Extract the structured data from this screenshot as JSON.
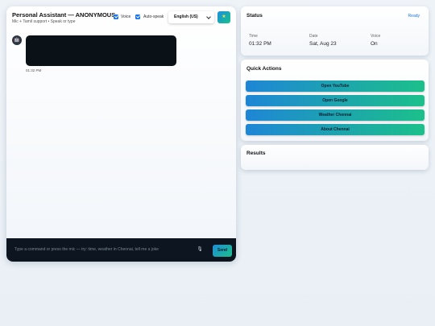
{
  "chat": {
    "title": "Personal Assistant — ANONYMOUS",
    "subtitle": "Mic + Tamil support • Speak or type",
    "voice_label": "Voice",
    "autospeak_label": "Auto-speak",
    "language": "English (US)",
    "avatar_glyph": "🤖",
    "star_glyph": "★",
    "messages": [
      {
        "sender": "assistant",
        "time": "01:32 PM",
        "content_hidden": true
      }
    ],
    "input_placeholder": "Type a command or press the mic — try: time, weather in Chennai, tell me a joke",
    "mic_glyph": "🎙",
    "send_label": "Send"
  },
  "status": {
    "title": "Status",
    "state": "Ready",
    "fields": [
      {
        "label": "Time",
        "value": "01:32 PM"
      },
      {
        "label": "Date",
        "value": "Sat, Aug 23"
      },
      {
        "label": "Voice",
        "value": "On"
      }
    ]
  },
  "quick_actions": {
    "title": "Quick Actions",
    "buttons": [
      {
        "label": "Open YouTube"
      },
      {
        "label": "Open Google"
      },
      {
        "label": "Weather Chennai"
      },
      {
        "label": "About Chennai"
      }
    ]
  },
  "results": {
    "title": "Results"
  },
  "colors": {
    "accent": "#1a73e8",
    "gradient_start": "#1e86d6",
    "gradient_end": "#1cc08a",
    "input_bar": "#0d1620",
    "message_bubble": "#0b1217"
  }
}
